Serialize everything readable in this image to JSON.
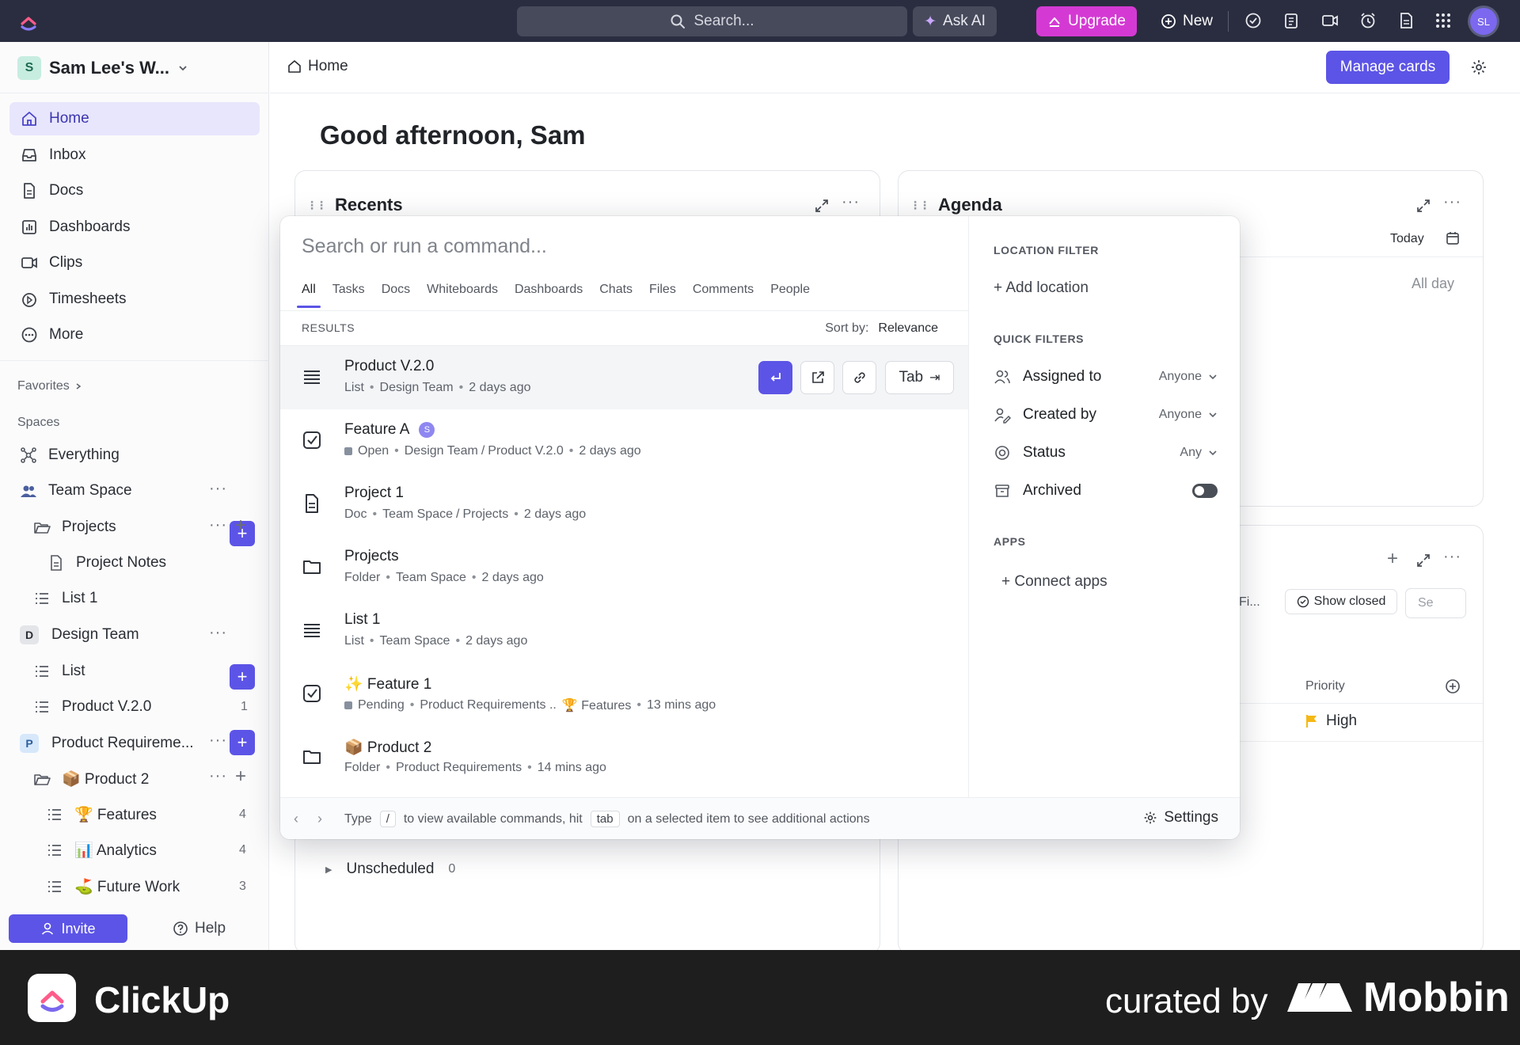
{
  "topbar": {
    "search_placeholder": "Search...",
    "ask_ai": "Ask AI",
    "upgrade": "Upgrade",
    "new": "New",
    "avatar_initials": "SL"
  },
  "sidebar": {
    "workspace_initial": "S",
    "workspace_name": "Sam Lee's W...",
    "nav": [
      {
        "label": "Home",
        "icon": "home-icon"
      },
      {
        "label": "Inbox",
        "icon": "inbox-icon"
      },
      {
        "label": "Docs",
        "icon": "doc-icon"
      },
      {
        "label": "Dashboards",
        "icon": "dashboard-icon"
      },
      {
        "label": "Clips",
        "icon": "clip-icon"
      },
      {
        "label": "Timesheets",
        "icon": "timer-icon"
      },
      {
        "label": "More",
        "icon": "more-icon"
      }
    ],
    "favorites_label": "Favorites",
    "spaces_label": "Spaces",
    "tree": {
      "everything": "Everything",
      "team_space": "Team Space",
      "projects": "Projects",
      "project_notes": "Project Notes",
      "list1": "List 1",
      "design_team_initial": "D",
      "design_team": "Design Team",
      "list": "List",
      "product_v2": "Product V.2.0",
      "product_v2_count": "1",
      "product_req_initial": "P",
      "product_req": "Product Requireme...",
      "product2": "📦 Product 2",
      "features": "🏆 Features",
      "features_count": "4",
      "analytics": "📊 Analytics",
      "analytics_count": "4",
      "future_work": "⛳ Future Work",
      "future_work_count": "3"
    },
    "invite": "Invite",
    "help": "Help"
  },
  "main": {
    "breadcrumb": "Home",
    "manage_cards": "Manage cards",
    "greeting": "Good afternoon, Sam",
    "recents_title": "Recents",
    "agenda_title": "Agenda",
    "agenda_today": "Today",
    "agenda_all_day": "All day",
    "tasks_show_closed": "Show closed",
    "tasks_filter_partial": "Fi...",
    "tasks_search_partial": "Se",
    "tasks_priority_header": "Priority",
    "tasks_priority_value": "High",
    "unscheduled_label": "Unscheduled",
    "unscheduled_count": "0"
  },
  "palette": {
    "search_placeholder": "Search or run a command...",
    "tabs": [
      "All",
      "Tasks",
      "Docs",
      "Whiteboards",
      "Dashboards",
      "Chats",
      "Files",
      "Comments",
      "People"
    ],
    "results_label": "RESULTS",
    "sort_label": "Sort by:",
    "sort_value": "Relevance",
    "results": [
      {
        "title": "Product V.2.0",
        "icon": "list-icon",
        "sub": [
          "List",
          "Design Team",
          "2 days ago"
        ]
      },
      {
        "title": "Feature A",
        "icon": "task-check-icon",
        "assignee": "S",
        "status": "Open",
        "sub": [
          "Design Team",
          "/",
          "Product V.2.0",
          "2 days ago"
        ]
      },
      {
        "title": "Project 1",
        "icon": "doc-icon",
        "sub": [
          "Doc",
          "Team Space",
          "/",
          "Projects",
          "2 days ago"
        ]
      },
      {
        "title": "Projects",
        "icon": "folder-icon",
        "sub": [
          "Folder",
          "Team Space",
          "2 days ago"
        ]
      },
      {
        "title": "List 1",
        "icon": "list-icon",
        "sub": [
          "List",
          "Team Space",
          "2 days ago"
        ]
      },
      {
        "title": "✨ Feature 1",
        "icon": "task-check-icon",
        "status": "Pending",
        "sub": [
          "Product Requirements ..",
          "🏆 Features",
          "13 mins ago"
        ]
      },
      {
        "title": "📦 Product 2",
        "icon": "folder-icon",
        "sub": [
          "Folder",
          "Product Requirements",
          "14 mins ago"
        ]
      }
    ],
    "tab_action": "Tab",
    "footer": {
      "type": "Type",
      "slash": "/",
      "mid": "to view available commands, hit",
      "tab_key": "tab",
      "end": "on a selected item to see additional actions",
      "settings": "Settings"
    },
    "right": {
      "location_label": "LOCATION FILTER",
      "add_location": "+ Add location",
      "quick_label": "QUICK FILTERS",
      "filters": [
        {
          "label": "Assigned to",
          "value": "Anyone",
          "icon": "assignee-icon"
        },
        {
          "label": "Created by",
          "value": "Anyone",
          "icon": "creator-icon"
        },
        {
          "label": "Status",
          "value": "Any",
          "icon": "status-icon"
        },
        {
          "label": "Archived",
          "icon": "archive-icon"
        }
      ],
      "apps_label": "APPS",
      "connect_apps": "+ Connect apps"
    }
  },
  "brand": {
    "app_name": "ClickUp",
    "curated": "curated by",
    "mobbin": "Mobbin"
  },
  "colors": {
    "accent": "#5c54e6",
    "topbar": "#2a2d3f",
    "upgrade": "#d43ad3",
    "priority_high": "#f5b814"
  }
}
